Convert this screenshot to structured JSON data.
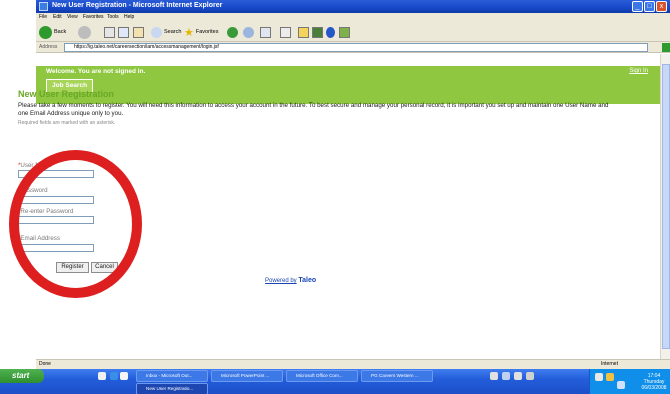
{
  "window": {
    "title": "New User Registration - Microsoft Internet Explorer",
    "min": "_",
    "max": "□",
    "close": "x"
  },
  "menu": [
    "File",
    "Edit",
    "View",
    "Favorites",
    "Tools",
    "Help"
  ],
  "toolbar": {
    "back": "Back",
    "search": "Search",
    "favorites": "Favorites"
  },
  "address": {
    "label": "Address",
    "url": "https://ig.taleo.net/careersection/iam/accessmanagement/login.jsf",
    "go": "Go"
  },
  "page": {
    "welcome": "Welcome. You are not signed in.",
    "sign_in": "Sign In",
    "tab": "Job Search",
    "heading": "New User Registration",
    "intro": "Please take a few moments to register. You will need this information to access your account in the future. To best secure and manage your personal record, it is important you set up and maintain one User Name and one Email Address unique only to you.",
    "required_note": "Required fields are marked with an asterisk.",
    "fields": {
      "username": "User Name",
      "password": "Password",
      "reenter": "Re-enter Password",
      "email": "Email Address"
    },
    "star": "*",
    "register": "Register",
    "cancel": "Cancel",
    "powered_by": "Powered by",
    "taleo": "Taleo"
  },
  "status": {
    "left": "Done",
    "right": "Internet"
  },
  "taskbar": {
    "start": "start",
    "tasks": [
      "Inbox - Microsoft Out...",
      "Microsoft PowerPoint ...",
      "Microsoft Office Com...",
      "PG Careers Western ...",
      "New User Registratio..."
    ],
    "clock_time": "17:04",
    "clock_day": "Thursday",
    "clock_date": "06/03/2008"
  },
  "colors": {
    "accent_green": "#8fc740",
    "heading_green": "#6aa828",
    "annotation_red": "#dd1f1f",
    "xp_blue": "#245edb"
  }
}
